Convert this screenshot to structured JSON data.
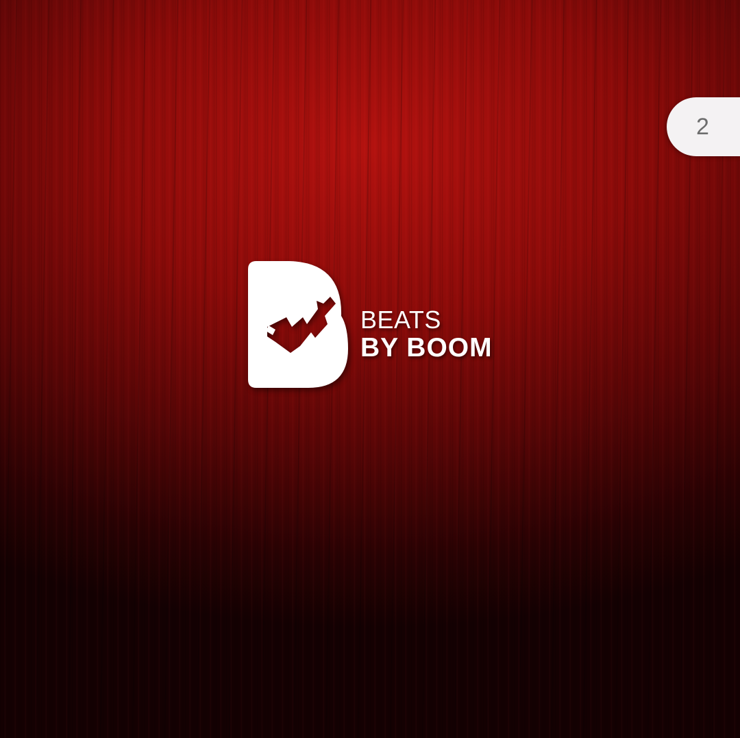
{
  "page_indicator": {
    "number": "2"
  },
  "brand": {
    "icon": "hand-b-logo",
    "line1": "BEATS",
    "line2": "BY BOOM"
  },
  "colors": {
    "background_top": "#b3120f",
    "background_bottom": "#140102",
    "logo": "#ffffff",
    "badge_background": "#f4f2f3",
    "badge_text": "#6d6d6d"
  }
}
